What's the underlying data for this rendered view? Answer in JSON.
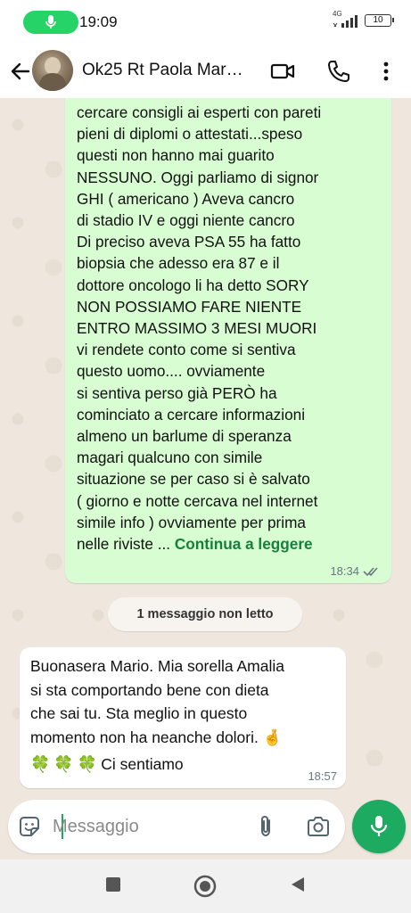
{
  "status": {
    "time": "19:09",
    "network": "4G",
    "battery": "10"
  },
  "header": {
    "title": "Ok25 Rt Paola Mar…",
    "icons": [
      "back-arrow-icon",
      "video-call-icon",
      "phone-icon",
      "more-vert-icon"
    ]
  },
  "messages": {
    "outgoing": {
      "text": "cercare consigli ai esperti con pareti\npieni di diplomi o attestati...speso\nquesti non hanno mai guarito\nNESSUNO. Oggi parliamo di signor\nGHI ( americano ) Aveva cancro\ndi stadio IV e oggi niente cancro\nDi preciso aveva PSA 55 ha fatto\nbiopsia che adesso era 87 e il\ndottore oncologo li ha detto SORY\nNON POSSIAMO FARE NIENTE\nENTRO MASSIMO 3 MESI MUORI\nvi rendete conto come si sentiva\nquesto uomo.... ovviamente\nsi sentiva perso già PERÒ ha\ncominciato a cercare informazioni\nalmeno un barlume di speranza\nmagari qualcuno con simile\nsituazione se per caso si è salvato\n( giorno e notte cercava nel internet\nsimile info ) ovviamente per prima\nnelle riviste ... ",
      "read_more": "Continua a leggere",
      "time": "18:34"
    },
    "unread_banner": "1 messaggio non letto",
    "incoming": {
      "lines": [
        "Buonasera Mario. Mia sorella Amalia",
        "si sta comportando bene con dieta",
        "che sai tu. Sta meglio in questo",
        "momento non ha neanche dolori. 🤞"
      ],
      "last_line": "Ci sentiamo",
      "clovers": [
        "🍀",
        "🍀",
        "🍀"
      ],
      "time": "18:57"
    }
  },
  "composer": {
    "placeholder": "Messaggio"
  },
  "colors": {
    "accent": "#1daa61",
    "outgoing_bubble": "#d9fdd3",
    "chat_bg": "#efe7de"
  }
}
